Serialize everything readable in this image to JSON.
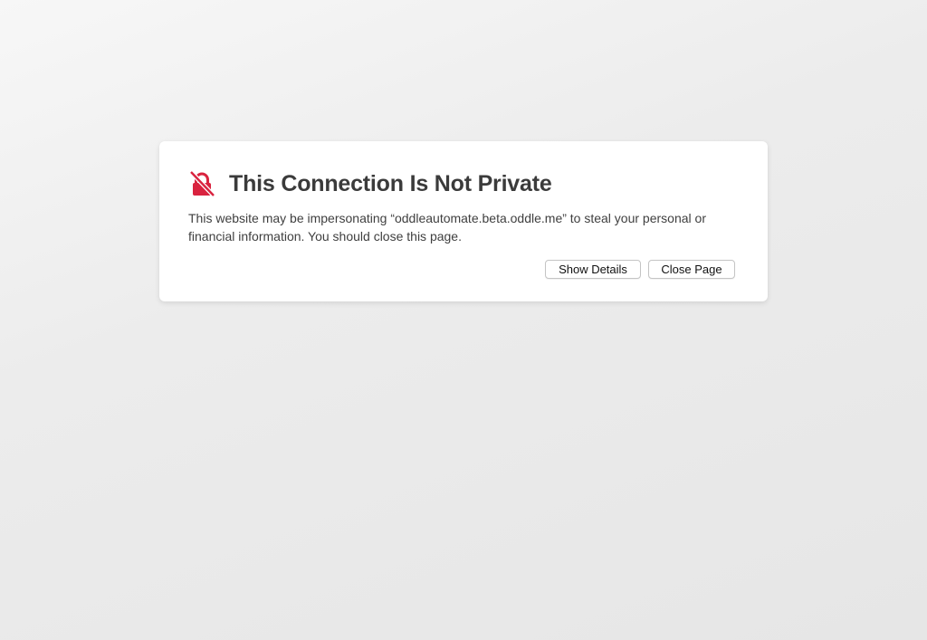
{
  "colors": {
    "accent": "#d9233f",
    "title": "#3b3b3b",
    "background": "#ececec"
  },
  "icon": "lock-slash-icon",
  "warning": {
    "title": "This Connection Is Not Private",
    "message": "This website may be impersonating “oddleautomate.beta.oddle.me” to steal your personal or financial information. You should close this page."
  },
  "buttons": {
    "show_details": "Show Details",
    "close_page": "Close Page"
  }
}
